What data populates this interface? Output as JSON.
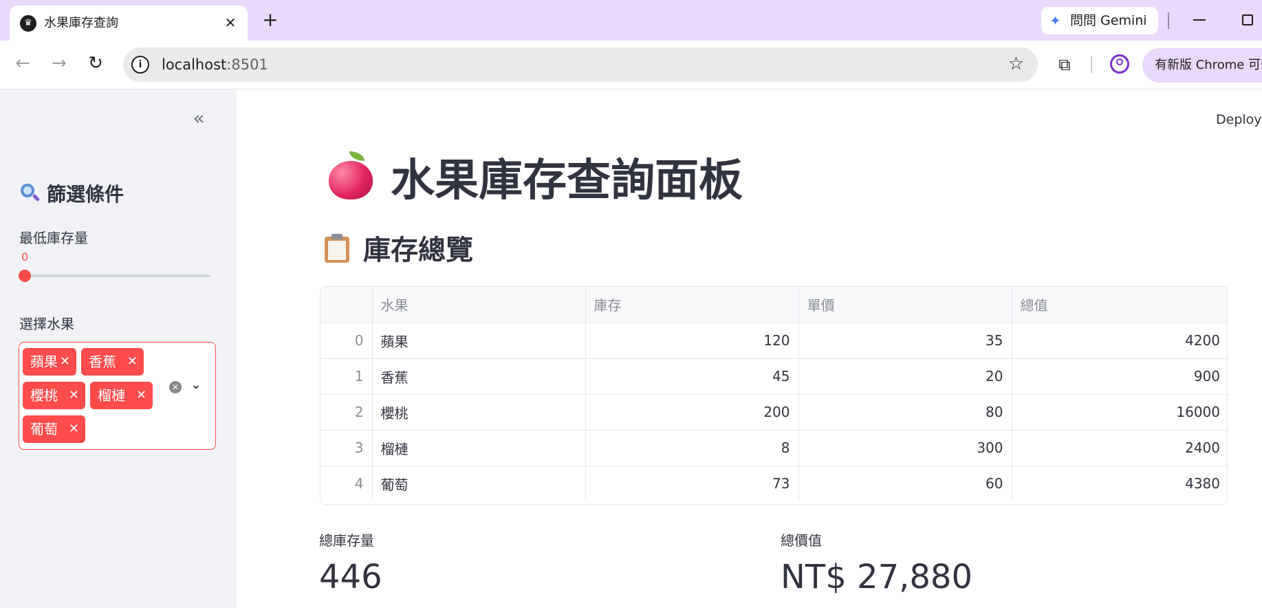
{
  "browser": {
    "tab_title": "水果庫存查詢",
    "tab_favicon": "crown-icon",
    "url_host": "localhost",
    "url_port": ":8501",
    "gemini_label": "問問 Gemini",
    "update_label": "有新版 Chrome 可安"
  },
  "header": {
    "deploy_label": "Deploy"
  },
  "sidebar": {
    "heading": "篩選條件",
    "heading_icon": "magnifier-icon",
    "slider": {
      "label": "最低庫存量",
      "value": "0",
      "fraction": 0
    },
    "multiselect": {
      "label": "選擇水果",
      "selected": [
        "蘋果",
        "香蕉",
        "櫻桃",
        "榴槤",
        "葡萄"
      ]
    }
  },
  "main": {
    "title": "水果庫存查詢面板",
    "title_icon": "apple-icon",
    "section_title": "庫存總覽",
    "section_icon": "clipboard-icon",
    "table": {
      "columns": [
        "",
        "水果",
        "庫存",
        "單價",
        "總值"
      ],
      "rows": [
        [
          "0",
          "蘋果",
          "120",
          "35",
          "4200"
        ],
        [
          "1",
          "香蕉",
          "45",
          "20",
          "900"
        ],
        [
          "2",
          "櫻桃",
          "200",
          "80",
          "16000"
        ],
        [
          "3",
          "榴槤",
          "8",
          "300",
          "2400"
        ],
        [
          "4",
          "葡萄",
          "73",
          "60",
          "4380"
        ]
      ]
    },
    "metrics": [
      {
        "label": "總庫存量",
        "value": "446"
      },
      {
        "label": "總價值",
        "value": "NT$ 27,880"
      }
    ]
  },
  "colors": {
    "accent": "#ff4b4b",
    "sidebar_bg": "#f0f2f6",
    "tabbar_bg": "#e9d9fb",
    "text": "#31333f"
  }
}
